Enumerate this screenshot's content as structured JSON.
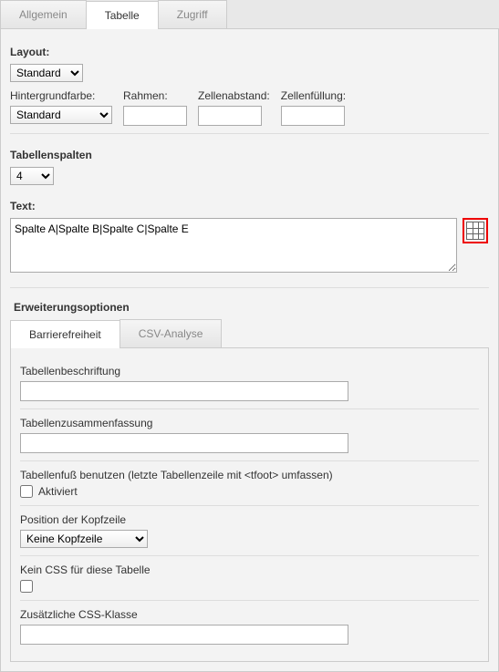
{
  "tabs": {
    "allgemein": "Allgemein",
    "tabelle": "Tabelle",
    "zugriff": "Zugriff"
  },
  "layout": {
    "label": "Layout:",
    "select": "Standard",
    "fields": {
      "hintergrund": {
        "label": "Hintergrundfarbe:",
        "select": "Standard"
      },
      "rahmen": {
        "label": "Rahmen:",
        "value": ""
      },
      "zellabstand": {
        "label": "Zellenabstand:",
        "value": ""
      },
      "zellfuellung": {
        "label": "Zellenfüllung:",
        "value": ""
      }
    }
  },
  "spalten": {
    "label": "Tabellenspalten",
    "value": "4"
  },
  "text": {
    "label": "Text:",
    "value": "Spalte A|Spalte B|Spalte C|Spalte E"
  },
  "ext": {
    "header": "Erweiterungsoptionen",
    "subtabs": {
      "barriere": "Barrierefreiheit",
      "csv": "CSV-Analyse"
    },
    "beschriftung": {
      "label": "Tabellenbeschriftung",
      "value": ""
    },
    "zusammenfassung": {
      "label": "Tabellenzusammenfassung",
      "value": ""
    },
    "tfoot": {
      "label": "Tabellenfuß benutzen (letzte Tabellenzeile mit <tfoot> umfassen)",
      "check": "Aktiviert"
    },
    "kopfzeile": {
      "label": "Position der Kopfzeile",
      "select": "Keine Kopfzeile"
    },
    "nocss": {
      "label": "Kein CSS für diese Tabelle"
    },
    "cssklasse": {
      "label": "Zusätzliche CSS-Klasse",
      "value": ""
    }
  }
}
